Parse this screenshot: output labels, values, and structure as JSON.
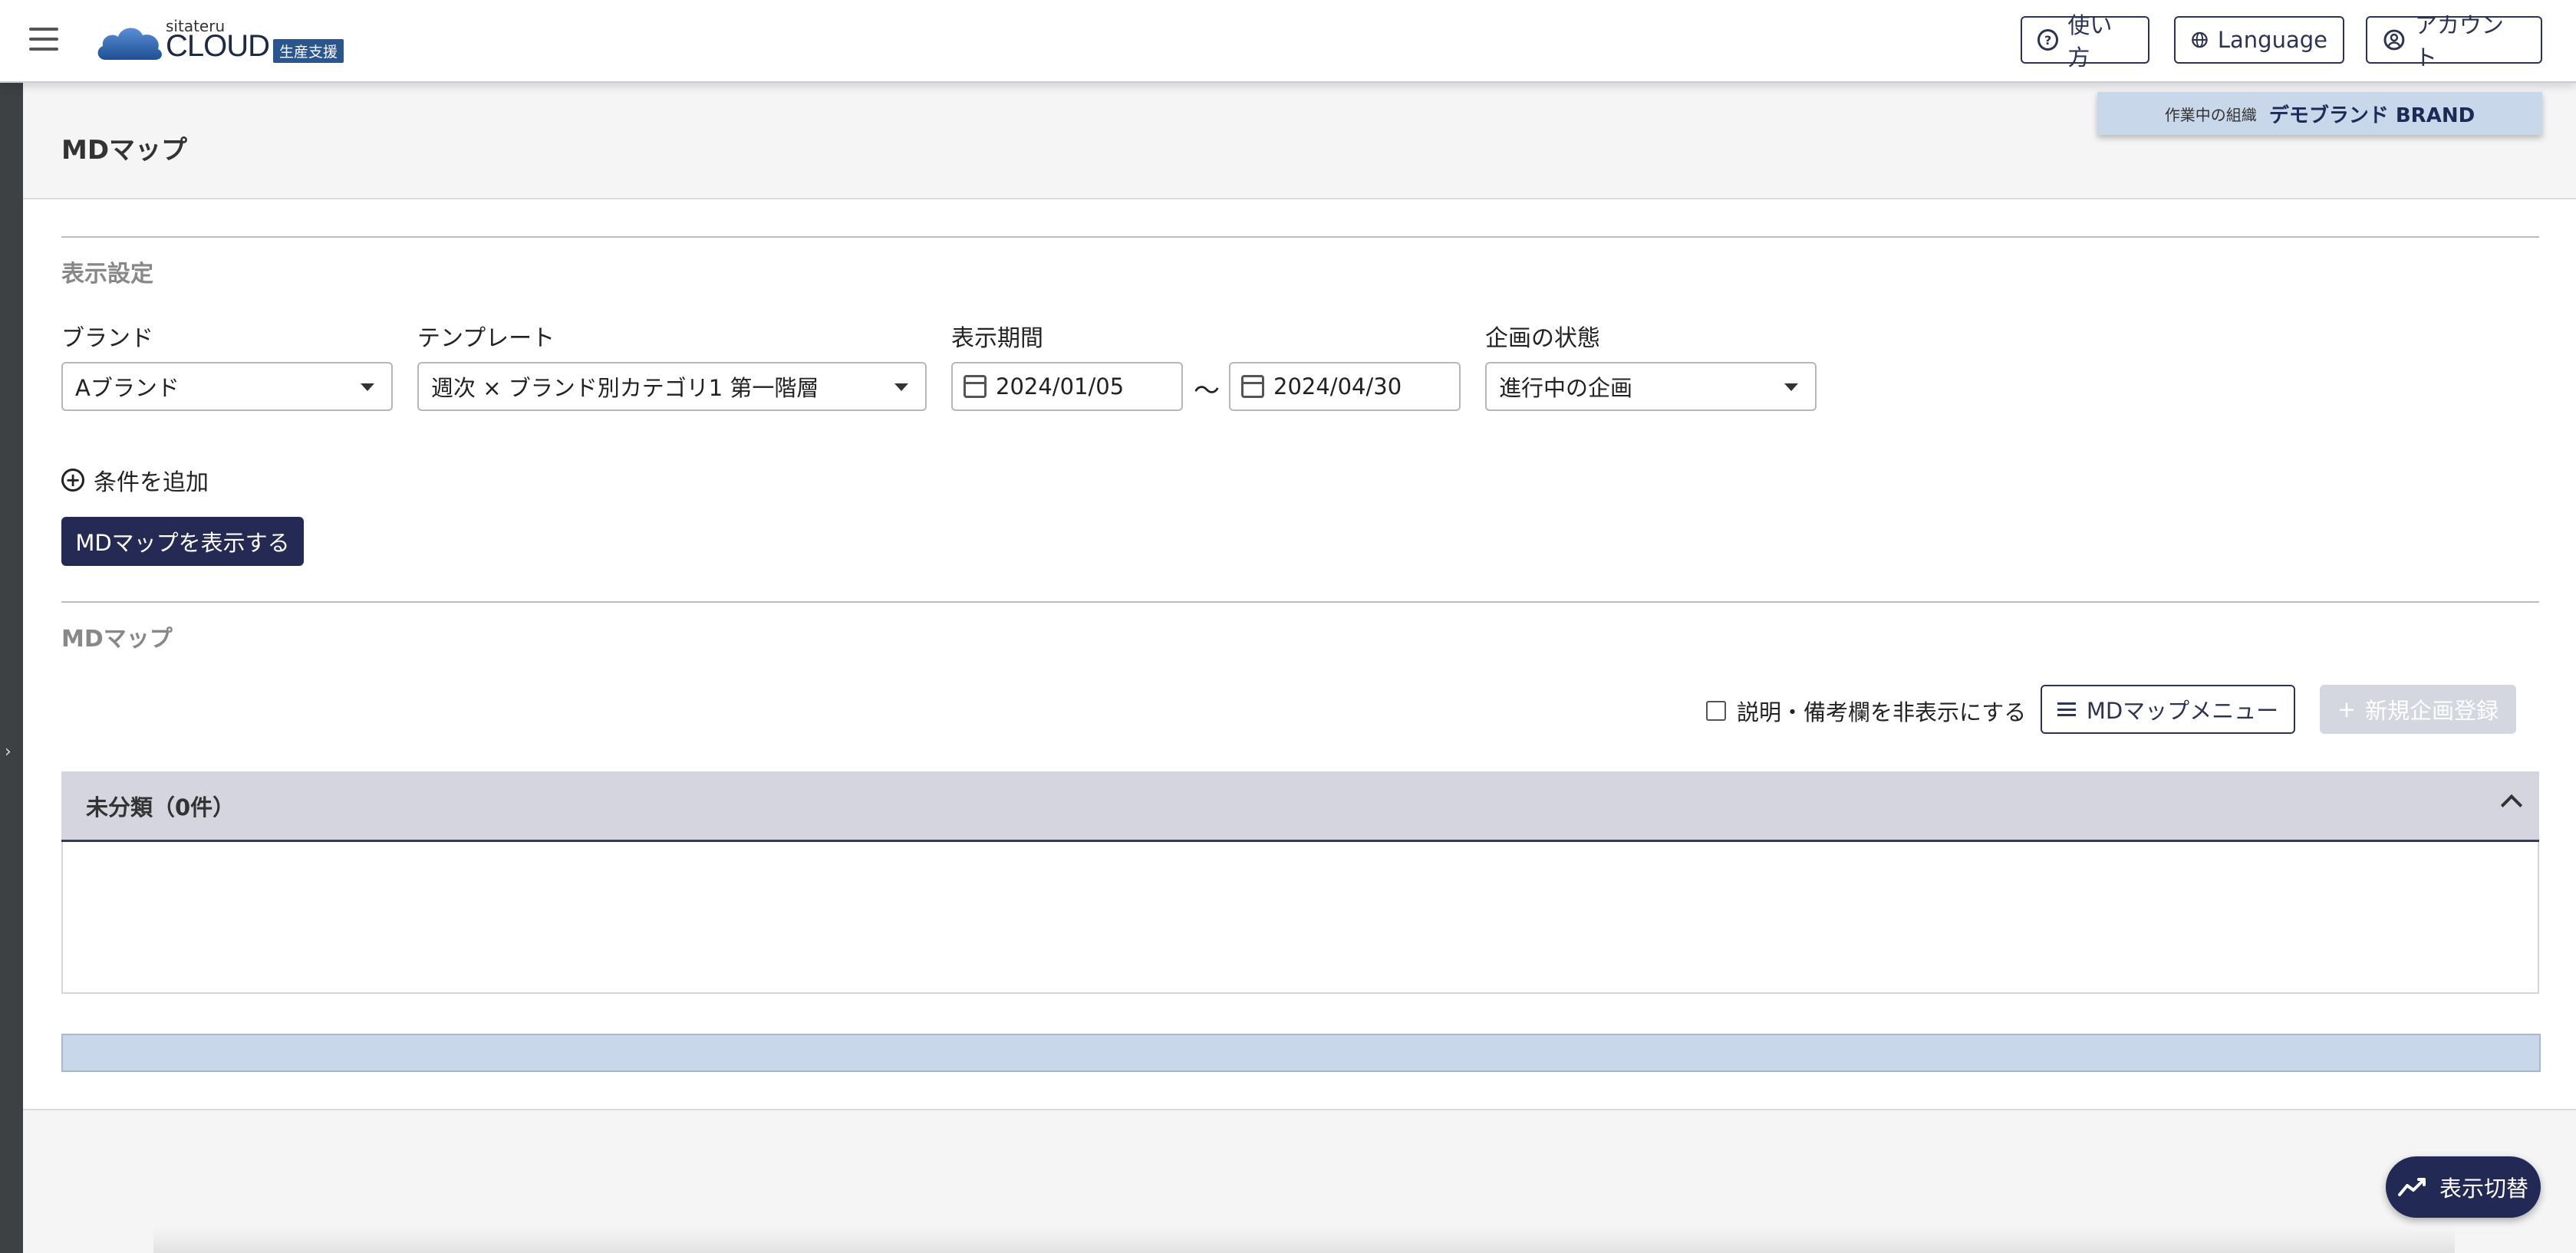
{
  "header": {
    "logo_small": "sitateru",
    "logo_main": "CLOUD",
    "logo_badge": "生産支援",
    "help_label": "使い方",
    "language_label": "Language",
    "account_label": "アカウント"
  },
  "org": {
    "label": "作業中の組織",
    "name": "デモブランド BRAND"
  },
  "page": {
    "title": "MDマップ"
  },
  "display_settings": {
    "section_title": "表示設定",
    "brand_label": "ブランド",
    "brand_value": "Aブランド",
    "template_label": "テンプレート",
    "template_value": "週次 × ブランド別カテゴリ1 第一階層",
    "period_label": "表示期間",
    "period_start": "2024/01/05",
    "period_separator": "〜",
    "period_end": "2024/04/30",
    "status_label": "企画の状態",
    "status_value": "進行中の企画",
    "add_condition_label": "条件を追加",
    "show_button_label": "MDマップを表示する"
  },
  "md_map": {
    "section_title": "MDマップ",
    "hide_notes_label": "説明・備考欄を非表示にする",
    "hide_notes_checked": false,
    "menu_button_label": "MDマップメニュー",
    "new_plan_label": "新規企画登録",
    "accordion_title": "未分類（0件）"
  },
  "fab": {
    "label": "表示切替"
  },
  "colors": {
    "primary": "#252a55",
    "accent_blue": "#2a5690",
    "org_bg": "#c9d7ea",
    "disabled": "#d4d7df"
  }
}
